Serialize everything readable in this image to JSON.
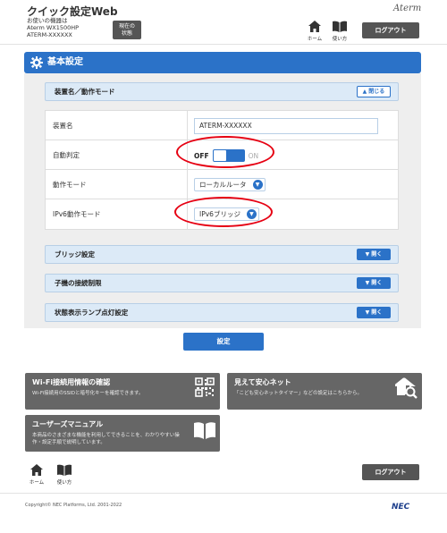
{
  "header": {
    "app_title": "クイック設定Web",
    "device_lines": [
      "お使いの機器は",
      "Aterm WX1500HP",
      "ATERM-XXXXXX"
    ],
    "status_button": [
      "現在の",
      "状態"
    ],
    "brand": "Aterm",
    "nav": [
      {
        "label": "ホーム",
        "icon": "home-icon"
      },
      {
        "label": "使い方",
        "icon": "book-icon"
      }
    ],
    "logout_label": "ログアウト"
  },
  "section": {
    "title": "基本設定",
    "icon": "gear-icon"
  },
  "panels": {
    "device": {
      "title": "装置名／動作モード",
      "toggle_label": "閉じる"
    },
    "bridge": {
      "title": "ブリッジ設定",
      "toggle_label": "開く"
    },
    "child": {
      "title": "子機の接続制限",
      "toggle_label": "開く"
    },
    "lamp": {
      "title": "状態表示ランプ点灯設定",
      "toggle_label": "開く"
    }
  },
  "settings": {
    "device_name": {
      "label": "装置名",
      "value": "ATERM-XXXXXX"
    },
    "auto_detect": {
      "label": "自動判定",
      "off_label": "OFF",
      "on_label": "ON",
      "state": "OFF"
    },
    "mode": {
      "label": "動作モード",
      "value": "ローカルルータ"
    },
    "ipv6_mode": {
      "label": "IPv6動作モード",
      "value": "IPv6ブリッジ"
    }
  },
  "set_button": "設定",
  "tiles": {
    "wifi": {
      "title": "Wi-Fi接続用情報の確認",
      "desc": "Wi-Fi接続用のSSIDと暗号化キーを確認できます。",
      "icon": "qr-code-icon"
    },
    "safety": {
      "title": "見えて安心ネット",
      "desc": "「こども安心ネットタイマー」などの設定はこちらから。",
      "icon": "house-search-icon"
    },
    "manual": {
      "title": "ユーザーズマニュアル",
      "desc": [
        "本商品のさまざまな機能を利用してできることを、わかりやすい操",
        "作・設定手順で説明しています。"
      ],
      "icon": "open-book-icon"
    }
  },
  "footer": {
    "nav": [
      {
        "label": "ホーム",
        "icon": "home-icon"
      },
      {
        "label": "使い方",
        "icon": "book-icon"
      }
    ],
    "logout_label": "ログアウト",
    "copyright": "Copyright© NEC Platforms, Ltd. 2001-2022",
    "logo": "NEC"
  },
  "colors": {
    "accent": "#2b72c8",
    "panel_head": "#dceaf7",
    "tile": "#666666",
    "dark_button": "#555555",
    "highlight": "#e60012"
  }
}
